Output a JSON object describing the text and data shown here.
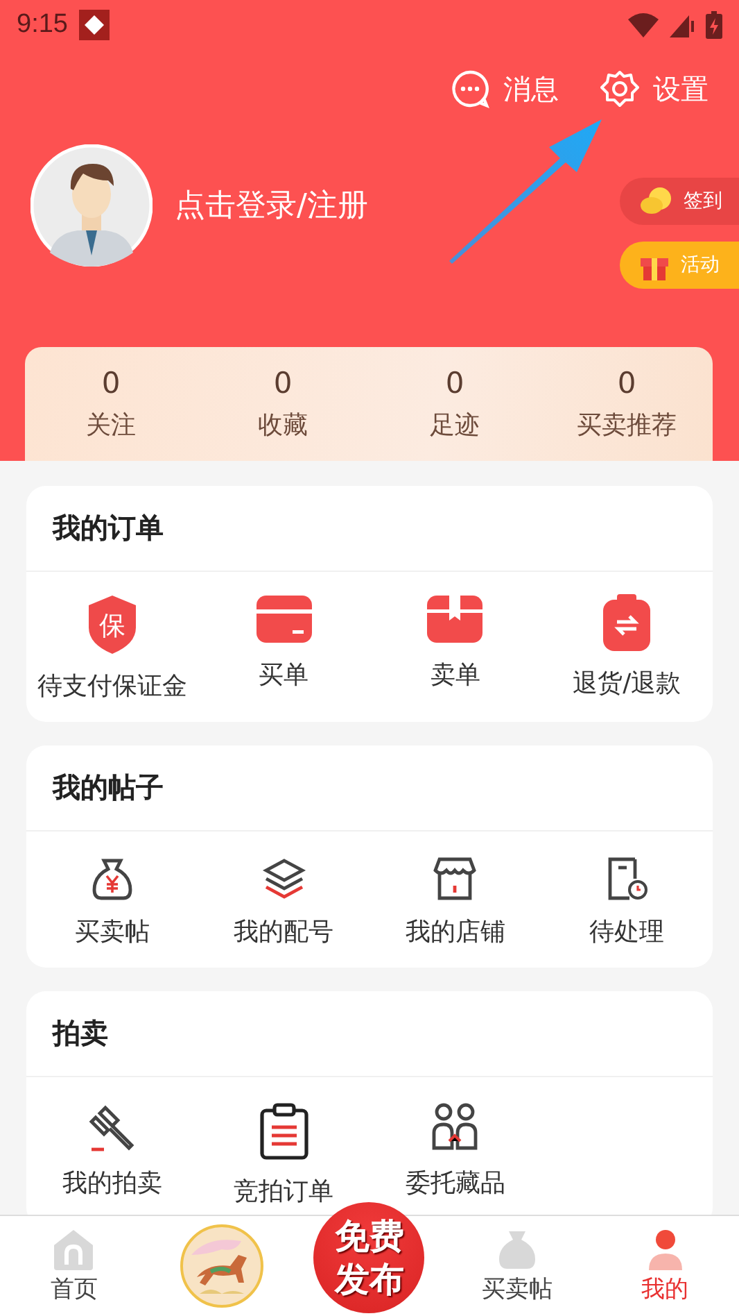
{
  "status_bar": {
    "time": "9:15"
  },
  "header": {
    "actions": [
      {
        "label": "消息"
      },
      {
        "label": "设置"
      }
    ],
    "login": "点击登录/注册",
    "pills": [
      {
        "label": "签到",
        "color": "#e84545"
      },
      {
        "label": "活动",
        "color": "#fdb21b"
      }
    ]
  },
  "stats": [
    {
      "value": "0",
      "label": "关注"
    },
    {
      "value": "0",
      "label": "收藏"
    },
    {
      "value": "0",
      "label": "足迹"
    },
    {
      "value": "0",
      "label": "买卖推荐"
    }
  ],
  "sections": [
    {
      "title": "我的订单",
      "kind": "filled",
      "items": [
        {
          "label": "待支付保证金",
          "icon_text": "保"
        },
        {
          "label": "买单"
        },
        {
          "label": "卖单"
        },
        {
          "label": "退货/退款"
        }
      ]
    },
    {
      "title": "我的帖子",
      "kind": "outline",
      "items": [
        {
          "label": "买卖帖"
        },
        {
          "label": "我的配号"
        },
        {
          "label": "我的店铺"
        },
        {
          "label": "待处理"
        }
      ]
    },
    {
      "title": "拍卖",
      "kind": "auction",
      "items": [
        {
          "label": "我的拍卖"
        },
        {
          "label": "竞拍订单"
        },
        {
          "label": "委托藏品"
        }
      ]
    }
  ],
  "bottom_nav": [
    {
      "kind": "tab",
      "label": "首页",
      "selected": false
    },
    {
      "kind": "picture"
    },
    {
      "kind": "publish",
      "label": "免费发布"
    },
    {
      "kind": "tab",
      "label": "买卖帖",
      "selected": false
    },
    {
      "kind": "tab",
      "label": "我的",
      "selected": true
    }
  ]
}
